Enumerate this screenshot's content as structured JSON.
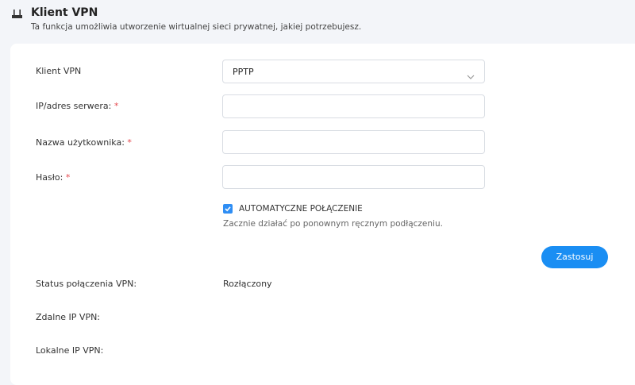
{
  "header": {
    "icon": "router-icon",
    "title": "Klient VPN",
    "subtitle": "Ta funkcja umożliwia utworzenie wirtualnej sieci prywatnej, jakiej potrzebujesz."
  },
  "form": {
    "client_label": "Klient VPN",
    "client_value": "PPTP",
    "server_label": "IP/adres serwera:",
    "username_label": "Nazwa użytkownika:",
    "password_label": "Hasło:",
    "required_mark": "*",
    "server_value": "",
    "username_value": "",
    "password_value": "",
    "auto_connect_label": "AUTOMATYCZNE POŁĄCZENIE",
    "auto_connect_checked": true,
    "auto_connect_hint": "Zacznie działać po ponownym ręcznym podłączeniu.",
    "apply_label": "Zastosuj"
  },
  "status": {
    "connection_label": "Status połączenia VPN:",
    "connection_value": "Rozłączony",
    "remote_ip_label": "Zdalne IP VPN:",
    "remote_ip_value": "",
    "local_ip_label": "Lokalne IP VPN:",
    "local_ip_value": ""
  },
  "colors": {
    "accent": "#1a8ef3",
    "required": "#e5484d",
    "background": "#f3f5f9"
  }
}
